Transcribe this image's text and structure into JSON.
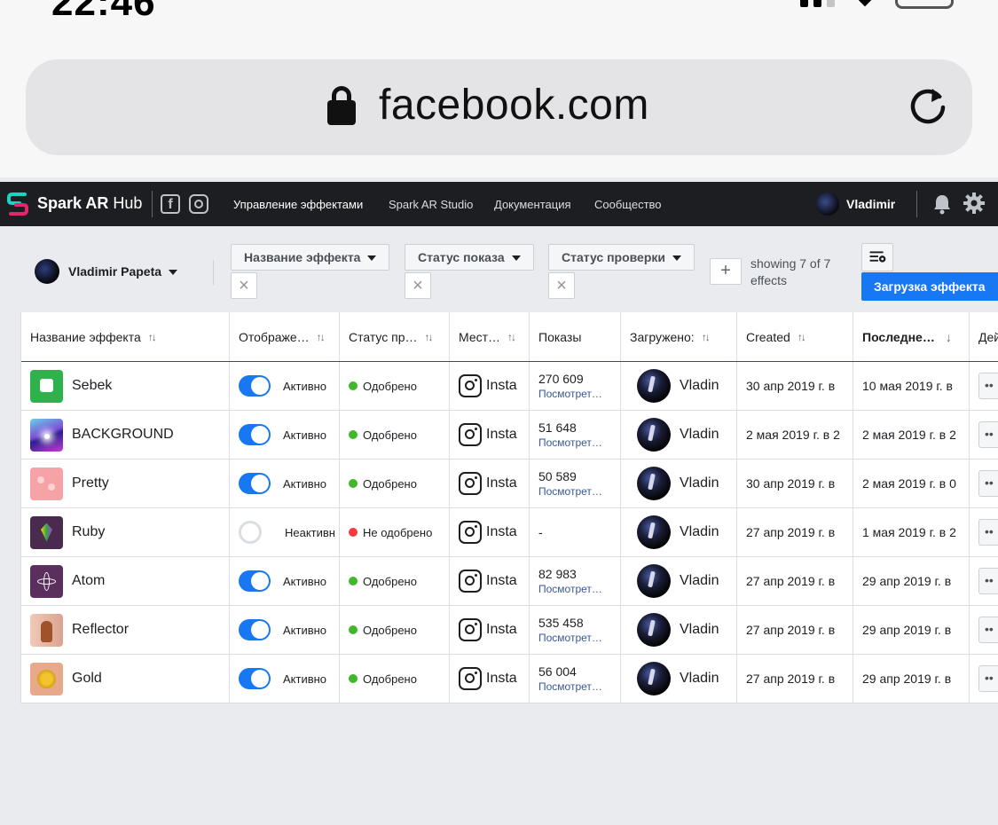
{
  "status_bar": {
    "time": "22:46"
  },
  "browser": {
    "url": "facebook.com"
  },
  "nav": {
    "logo_bold": "Spark AR",
    "logo_light": " Hub",
    "links": [
      "Управление эффектами",
      "Spark AR Studio",
      "Документация",
      "Сообщество"
    ],
    "user": "Vladimir"
  },
  "filters": {
    "account": "Vladimir Papeta",
    "buttons": [
      "Название эффекта",
      "Статус показа",
      "Статус проверки"
    ],
    "count": "showing 7 of 7 effects",
    "upload": "Загрузка эффекта"
  },
  "table": {
    "headers": [
      "Название эффекта",
      "Отображе…",
      "Статус пр…",
      "Мест…",
      "Показы",
      "Загружено:",
      "Created",
      "Последне…",
      "Дей"
    ],
    "rows": [
      {
        "name": "Sebek",
        "toggle_on": true,
        "toggle_label": "Активно",
        "review": "Одобрено",
        "review_color": "#42b72a",
        "place": "Insta",
        "impressions": "270 609",
        "view_link": "Посмотрет…",
        "uploader": "Vladin",
        "created": "30 апр 2019 г. в",
        "updated": "10 мая 2019 г. в"
      },
      {
        "name": "BACKGROUND",
        "toggle_on": true,
        "toggle_label": "Активно",
        "review": "Одобрено",
        "review_color": "#42b72a",
        "place": "Insta",
        "impressions": "51 648",
        "view_link": "Посмотрет…",
        "uploader": "Vladin",
        "created": "2 мая 2019 г. в 2",
        "updated": "2 мая 2019 г. в 2"
      },
      {
        "name": "Pretty",
        "toggle_on": true,
        "toggle_label": "Активно",
        "review": "Одобрено",
        "review_color": "#42b72a",
        "place": "Insta",
        "impressions": "50 589",
        "view_link": "Посмотрет…",
        "uploader": "Vladin",
        "created": "30 апр 2019 г. в",
        "updated": "2 мая 2019 г. в 0"
      },
      {
        "name": "Ruby",
        "toggle_on": false,
        "toggle_label": "Неактивн",
        "review": "Не одобрено",
        "review_color": "#fa383e",
        "place": "Insta",
        "impressions": "-",
        "view_link": "",
        "uploader": "Vladin",
        "created": "27 апр 2019 г. в",
        "updated": "1 мая 2019 г. в 2"
      },
      {
        "name": "Atom",
        "toggle_on": true,
        "toggle_label": "Активно",
        "review": "Одобрено",
        "review_color": "#42b72a",
        "place": "Insta",
        "impressions": "82 983",
        "view_link": "Посмотрет…",
        "uploader": "Vladin",
        "created": "27 апр 2019 г. в",
        "updated": "29 апр 2019 г. в"
      },
      {
        "name": "Reflector",
        "toggle_on": true,
        "toggle_label": "Активно",
        "review": "Одобрено",
        "review_color": "#42b72a",
        "place": "Insta",
        "impressions": "535 458",
        "view_link": "Посмотрет…",
        "uploader": "Vladin",
        "created": "27 апр 2019 г. в",
        "updated": "29 апр 2019 г. в"
      },
      {
        "name": "Gold",
        "toggle_on": true,
        "toggle_label": "Активно",
        "review": "Одобрено",
        "review_color": "#42b72a",
        "place": "Insta",
        "impressions": "56 004",
        "view_link": "Посмотрет…",
        "uploader": "Vladin",
        "created": "27 апр 2019 г. в",
        "updated": "29 апр 2019 г. в"
      }
    ]
  }
}
